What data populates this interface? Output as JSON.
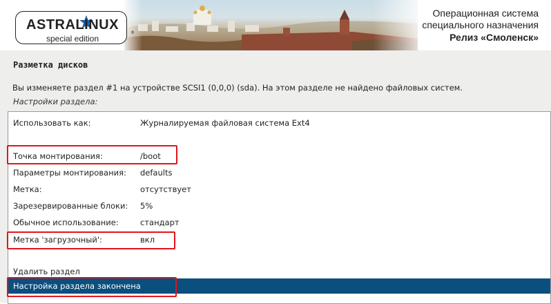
{
  "banner": {
    "logo_text": "ASTRALINUX",
    "logo_registered": "®",
    "logo_subtitle": "special edition",
    "os_title_line1": "Операционная система",
    "os_title_line2": "специального назначения",
    "release": "Релиз «Смоленск»"
  },
  "page": {
    "title": "Разметка дисков",
    "description": "Вы изменяете раздел #1 на устройстве SCSI1 (0,0,0) (sda). На этом разделе не найдено файловых систем.",
    "section_label": "Настройки раздела:"
  },
  "settings": [
    {
      "label": "Использовать как:",
      "value": "Журналируемая файловая система Ext4"
    },
    {
      "label": "Точка монтирования:",
      "value": "/boot"
    },
    {
      "label": "Параметры монтирования:",
      "value": "defaults"
    },
    {
      "label": "Метка:",
      "value": "отсутствует"
    },
    {
      "label": "Зарезервированные блоки:",
      "value": "5%"
    },
    {
      "label": "Обычное использование:",
      "value": "стандарт"
    },
    {
      "label": "Метка 'загрузочный':",
      "value": "вкл"
    }
  ],
  "actions": {
    "delete_partition": "Удалить раздел",
    "done_setting_up": "Настройка раздела закончена"
  },
  "colors": {
    "selection": "#0b4f7e",
    "highlight_box": "#e0141a",
    "background": "#eeeeec"
  },
  "icons": {
    "logo_star": "star-icon"
  }
}
